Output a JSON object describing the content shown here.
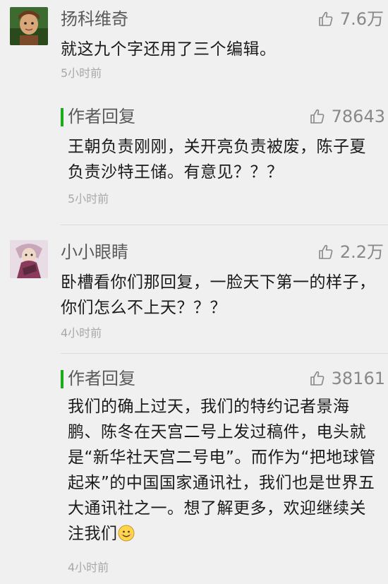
{
  "comments": [
    {
      "username": "扬科维奇",
      "likes": "7.6万",
      "text": "就这九个字还用了三个编辑。",
      "time": "5小时前",
      "reply": {
        "title": "作者回复",
        "likes": "78643",
        "text": "王朝负责刚刚，关开亮负责被废，陈子夏负责沙特王储。有意见？？？",
        "time": "5小时前"
      }
    },
    {
      "username": "小小眼睛",
      "likes": "2.2万",
      "text": "卧槽看你们那回复，一脸天下第一的样子，你们怎么不上天？？？",
      "time": "4小时前",
      "reply": {
        "title": "作者回复",
        "likes": "38161",
        "text": "我们的确上过天，我们的特约记者景海鹏、陈冬在天宫二号上发过稿件，电头就是“新华社天宫二号电”。而作为“把地球管起来”的中国国家通讯社，我们也是世界五大通讯社之一。想了解更多，欢迎继续关注我们",
        "time": "4小时前",
        "emoji": "smiley-icon"
      }
    }
  ],
  "colors": {
    "background": "#f0f0f0",
    "accent_green": "#1aad19",
    "meta_gray": "#a8a8a8"
  }
}
